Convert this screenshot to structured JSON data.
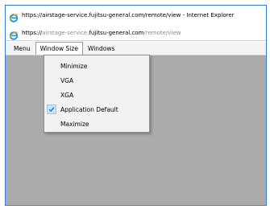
{
  "window": {
    "title": "https://airstage-service.fujitsu-general.com/remote/view - Internet Explorer"
  },
  "address": {
    "scheme": "https://",
    "subdomain": "airstage-service.",
    "domain": "fujitsu-general.com",
    "path": "/remote/view"
  },
  "menubar": {
    "items": [
      "Menu",
      "Window Size",
      "Windows"
    ]
  },
  "dropdown": {
    "items": [
      {
        "label": "Minimize",
        "checked": false
      },
      {
        "label": "VGA",
        "checked": false
      },
      {
        "label": "XGA",
        "checked": false
      },
      {
        "label": "Application Default",
        "checked": true
      },
      {
        "label": "Maximize",
        "checked": false
      }
    ]
  },
  "colors": {
    "window_border": "#2f7fd8",
    "content_background": "#ababab",
    "check_highlight": "#cce4f7",
    "check_mark": "#1c64b4"
  },
  "icons": {
    "title": "internet-explorer-icon",
    "address": "internet-explorer-icon",
    "checked": "checkmark-icon"
  }
}
